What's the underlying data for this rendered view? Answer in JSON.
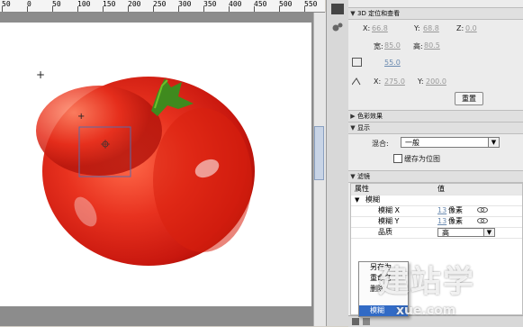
{
  "ruler": {
    "ticks": [
      "50",
      "0",
      "50",
      "100",
      "150",
      "200",
      "250",
      "300",
      "350",
      "400",
      "450",
      "500",
      "550"
    ]
  },
  "panel": {
    "header_3d": "3D 定位和查看",
    "x_label": "X:",
    "x_value": "66.8",
    "y_label": "Y:",
    "y_value": "68.8",
    "z_label": "Z:",
    "z_value": "0.0",
    "width_label": "宽:",
    "width_value": "85.0",
    "height_label": "高:",
    "height_value": "80.5",
    "persp_value": "55.0",
    "vp_x_label": "X:",
    "vp_x_value": "275.0",
    "vp_y_label": "Y:",
    "vp_y_value": "200.0",
    "reset_button": "重置",
    "color_effect_header": "色彩效果",
    "display_header": "显示",
    "blend_label": "混合:",
    "blend_value": "一般",
    "cache_label": "缓存为位图",
    "filter_header": "滤镜",
    "col_property": "属性",
    "col_value": "值",
    "filter_name": "模糊",
    "blur_x_label": "模糊 X",
    "blur_x_value": "13",
    "blur_x_unit": "像素",
    "blur_y_label": "模糊 Y",
    "blur_y_value": "13",
    "blur_y_unit": "像素",
    "quality_label": "品质",
    "quality_value": "高"
  },
  "context_menu": {
    "items": [
      "另存为",
      "重命名",
      "删除",
      "模糊"
    ]
  },
  "watermark": {
    "main": "建站学",
    "sub": "xue.com"
  },
  "colors": {
    "accent": "#316ac5",
    "tomato": "#e0251a",
    "link": "#6a8ab0"
  }
}
